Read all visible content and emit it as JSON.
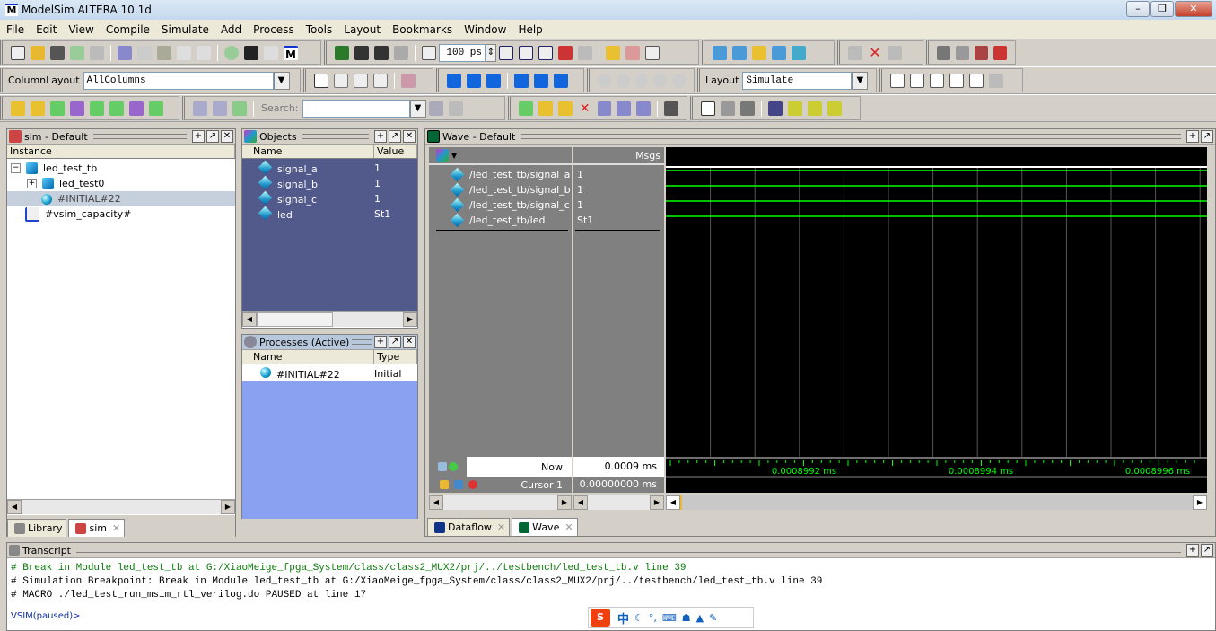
{
  "window": {
    "title": "ModelSim ALTERA 10.1d",
    "logo": "M"
  },
  "menu": [
    "File",
    "Edit",
    "View",
    "Compile",
    "Simulate",
    "Add",
    "Process",
    "Tools",
    "Layout",
    "Bookmarks",
    "Window",
    "Help"
  ],
  "toolbar": {
    "run_length": "100 ps",
    "column_layout_label": "ColumnLayout",
    "column_layout_value": "AllColumns",
    "layout_label": "Layout",
    "layout_value": "Simulate",
    "search_label": "Search:",
    "search_value": ""
  },
  "sim_pane": {
    "title": "sim - Default",
    "column": "Instance",
    "items": [
      {
        "label": "led_test_tb",
        "expander": "−"
      },
      {
        "label": "led_test0",
        "expander": "+"
      },
      {
        "label": "#INITIAL#22"
      },
      {
        "label": "#vsim_capacity#"
      }
    ],
    "tabs": [
      {
        "label": "Library"
      },
      {
        "label": "sim"
      }
    ]
  },
  "objects_pane": {
    "title": "Objects",
    "columns": [
      "Name",
      "Value"
    ],
    "rows": [
      {
        "name": "signal_a",
        "value": "1"
      },
      {
        "name": "signal_b",
        "value": "1"
      },
      {
        "name": "signal_c",
        "value": "1"
      },
      {
        "name": "led",
        "value": "St1"
      }
    ]
  },
  "processes_pane": {
    "title": "Processes (Active)",
    "columns": [
      "Name",
      "Type (filt"
    ],
    "rows": [
      {
        "name": "#INITIAL#22",
        "type": "Initial"
      }
    ]
  },
  "wave_pane": {
    "title": "Wave - Default",
    "msgs_header": "Msgs",
    "signals": [
      {
        "name": "/led_test_tb/signal_a",
        "value": "1"
      },
      {
        "name": "/led_test_tb/signal_b",
        "value": "1"
      },
      {
        "name": "/led_test_tb/signal_c",
        "value": "1"
      },
      {
        "name": "/led_test_tb/led",
        "value": "St1"
      }
    ],
    "now_label": "Now",
    "now_value": "0.0009 ms",
    "cursor_label": "Cursor 1",
    "cursor_value": "0.00000000 ms",
    "time_ticks": [
      "0.0008992 ms",
      "0.0008994 ms",
      "0.0008996 ms"
    ],
    "wave_color": "#00ff00",
    "tabs": [
      {
        "label": "Dataflow"
      },
      {
        "label": "Wave"
      }
    ]
  },
  "transcript": {
    "title": "Transcript",
    "lines": [
      "# Break in Module led_test_tb at G:/XiaoMeige_fpga_System/class/class2_MUX2/prj/../testbench/led_test_tb.v line 39",
      "# Simulation Breakpoint: Break in Module led_test_tb at G:/XiaoMeige_fpga_System/class/class2_MUX2/prj/../testbench/led_test_tb.v line 39",
      "# MACRO ./led_test_run_msim_rtl_verilog.do PAUSED at line 17"
    ],
    "prompt": "VSIM(paused)>"
  },
  "ime_bar": {
    "logo": "S",
    "lang": "中"
  }
}
